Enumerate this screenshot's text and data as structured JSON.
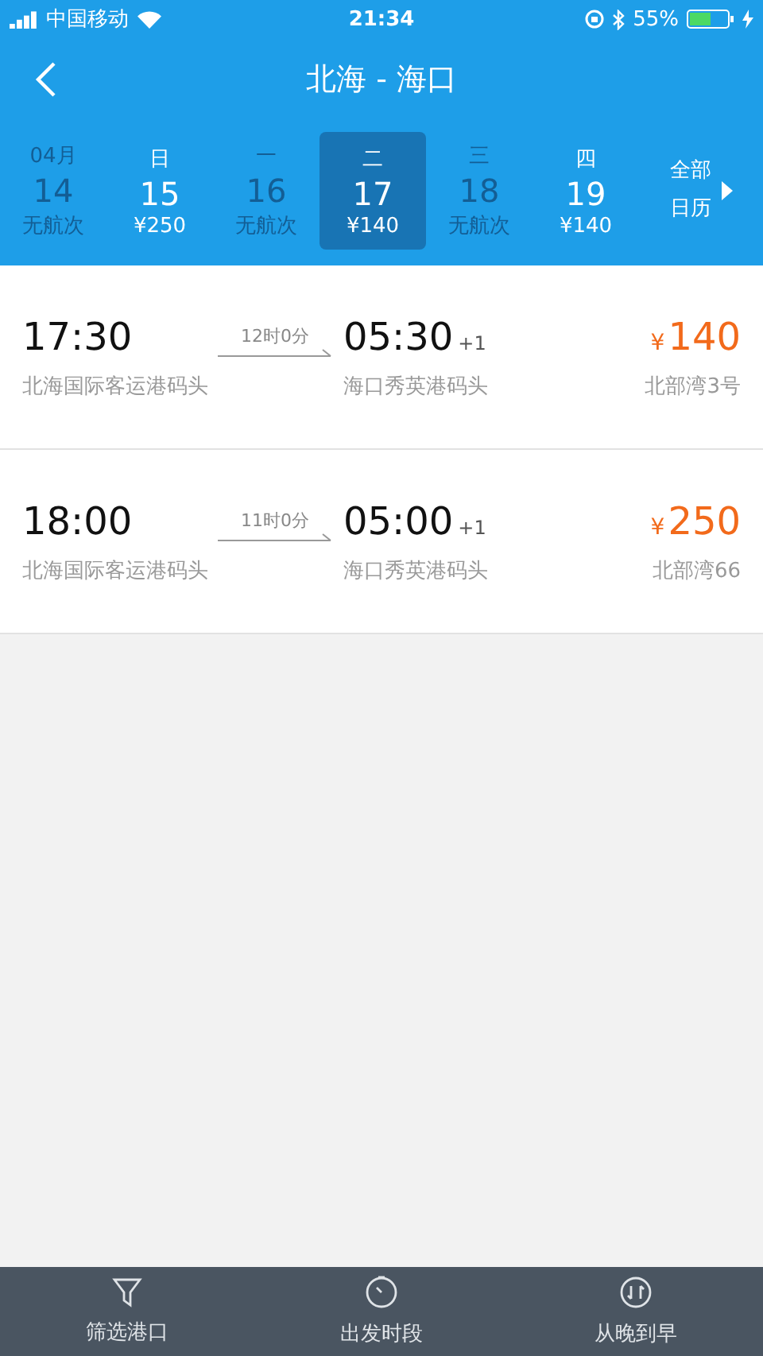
{
  "status_bar": {
    "carrier": "中国移动",
    "time": "21:34",
    "battery": "55%"
  },
  "nav": {
    "title": "北海 - 海口"
  },
  "dates": [
    {
      "weekday": "04月",
      "day": "14",
      "price": "无航次",
      "available": false,
      "selected": false
    },
    {
      "weekday": "日",
      "day": "15",
      "price": "¥250",
      "available": true,
      "selected": false
    },
    {
      "weekday": "一",
      "day": "16",
      "price": "无航次",
      "available": false,
      "selected": false
    },
    {
      "weekday": "二",
      "day": "17",
      "price": "¥140",
      "available": true,
      "selected": true
    },
    {
      "weekday": "三",
      "day": "18",
      "price": "无航次",
      "available": false,
      "selected": false
    },
    {
      "weekday": "四",
      "day": "19",
      "price": "¥140",
      "available": true,
      "selected": false
    }
  ],
  "calendar_link": {
    "line1": "全部",
    "line2": "日历"
  },
  "sailings": [
    {
      "depart_time": "17:30",
      "duration": "12时0分",
      "arrive_time": "05:30",
      "day_offset": "+1",
      "currency": "¥",
      "price": "140",
      "from_port": "北海国际客运港码头",
      "to_port": "海口秀英港码头",
      "ship": "北部湾3号"
    },
    {
      "depart_time": "18:00",
      "duration": "11时0分",
      "arrive_time": "05:00",
      "day_offset": "+1",
      "currency": "¥",
      "price": "250",
      "from_port": "北海国际客运港码头",
      "to_port": "海口秀英港码头",
      "ship": "北部湾66"
    }
  ],
  "bottom_bar": [
    {
      "kind": "filter",
      "label": "筛选港口"
    },
    {
      "kind": "clock",
      "label": "出发时段"
    },
    {
      "kind": "sort",
      "label": "从晚到早"
    }
  ]
}
